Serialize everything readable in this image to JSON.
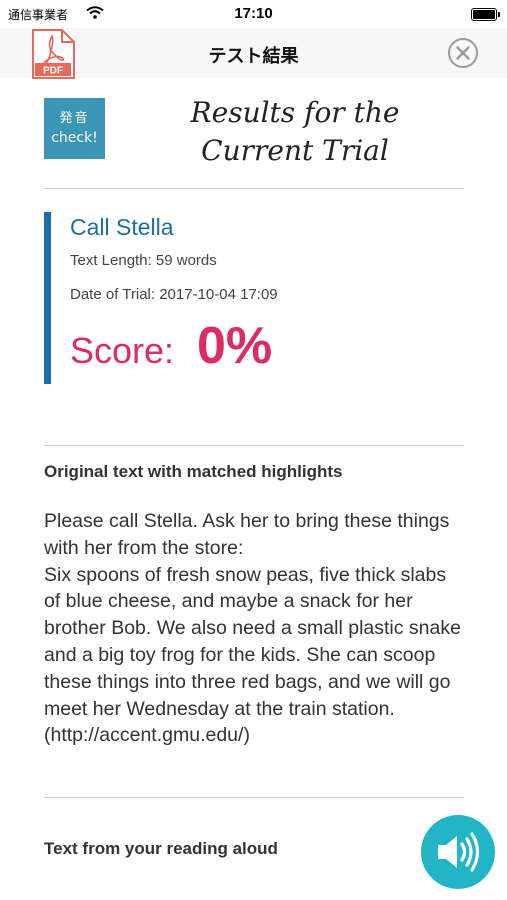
{
  "status_bar": {
    "carrier": "通信事業者",
    "time": "17:10"
  },
  "nav": {
    "title": "テスト結果",
    "pdf_label": "PDF"
  },
  "header": {
    "logo_line1": "発音",
    "logo_line2": "check!",
    "title": "Results for the Current Trial"
  },
  "trial": {
    "title": "Call Stella",
    "text_length": "Text Length: 59 words",
    "date": "Date of Trial: 2017-10-04 17:09",
    "score_label": "Score:",
    "score_value": "0%"
  },
  "original_section": {
    "heading": "Original text with matched highlights",
    "text": "Please call Stella. Ask her to bring these things with her from the store:\nSix spoons of fresh snow peas, five thick slabs of blue cheese, and maybe a snack for her brother Bob. We also need a small plastic snake and a big toy frog for the kids. She can scoop these things into three red bags, and we will go meet her Wednesday at the train station.\n(http://accent.gmu.edu/)"
  },
  "reading_section": {
    "heading": "Text from your reading aloud"
  },
  "colors": {
    "accent_blue": "#1b6fa8",
    "score_pink": "#dd2c62",
    "logo_blue": "#3a95b7",
    "speaker_teal": "#22b5c7",
    "pdf_red": "#e8685a"
  }
}
